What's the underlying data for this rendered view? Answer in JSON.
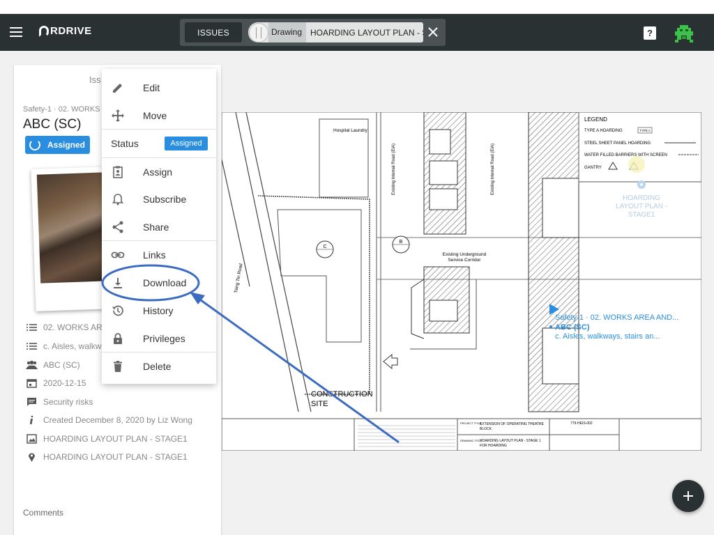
{
  "app": {
    "logo_text": "RDRIVE"
  },
  "header": {
    "tab_issues": "ISSUES",
    "tab_drawing_kind": "Drawing",
    "tab_drawing_title": "HOARDING LAYOUT PLAN - STAGE1",
    "help_label": "?"
  },
  "panel": {
    "tab_title": "Iss",
    "subtitle": "Safety-1 · 02. WORKS",
    "title": "ABC (SC)",
    "status_label": "Assigned",
    "meta": [
      {
        "icon": "list-icon",
        "text": "02. WORKS ARE"
      },
      {
        "icon": "list-icon",
        "text": "c. Aisles, walkw"
      },
      {
        "icon": "people-icon",
        "text": "ABC (SC)"
      },
      {
        "icon": "calendar-icon",
        "text": "2020-12-15"
      },
      {
        "icon": "chat-icon",
        "text": "Security risks"
      },
      {
        "icon": "info-icon",
        "text": "Created December 8, 2020 by Liz Wong"
      },
      {
        "icon": "image-icon",
        "text": "HOARDING LAYOUT PLAN - STAGE1"
      },
      {
        "icon": "location-icon",
        "text": "HOARDING LAYOUT PLAN - STAGE1"
      }
    ],
    "comments_label": "Comments"
  },
  "menu": {
    "edit": "Edit",
    "move": "Move",
    "status_label": "Status",
    "status_value": "Assigned",
    "assign": "Assign",
    "subscribe": "Subscribe",
    "share": "Share",
    "links": "Links",
    "download": "Download",
    "history": "History",
    "privileges": "Privileges",
    "delete": "Delete"
  },
  "drawing": {
    "legend_title": "LEGEND",
    "legend_items": [
      "TYPE A HOARDING",
      "STEEL SHEET PANEL HOARDING",
      "WATER FILLED BARRIERS WITH SCREEN",
      "GANTRY"
    ],
    "legend_badge": "TYPE A",
    "pin_label_1": "HOARDING",
    "pin_label_2": "LAYOUT PLAN -",
    "pin_label_3": "STAGE1",
    "issue_line_1": "Safety-1 · 02. WORKS AREA AND...",
    "issue_line_2": "ABC (SC)",
    "issue_line_3": "c. Aisles, walkways, stairs an...",
    "hospital_laundry": "Hospital Laundry",
    "road_1": "Existing Internal Road (EIA)",
    "road_2": "Existing Internal Road (EIA)",
    "corridor_1": "Existing Underground",
    "corridor_2": "Service Corridor",
    "road_3": "Tsing Tin Road",
    "marker_c": "C",
    "marker_b": "B",
    "construction_1": "CONSTRUCTION",
    "construction_2": "SITE",
    "project_title_label": "PROJECT TITLE",
    "project_title_1": "EXTENSION OF OPERATING THEATRE",
    "project_title_2": "BLOCK",
    "drawing_title_label": "DRAWING TITLE",
    "drawing_title_1": "HOARDING LAYOUT PLAN - STAGE 1",
    "drawing_title_2": "FOR HOARDING",
    "drawing_no": "779-HEIS-002"
  },
  "colors": {
    "appbar": "#2a3132",
    "accent": "#2a8ee0",
    "annotation": "#3c6cc0"
  }
}
